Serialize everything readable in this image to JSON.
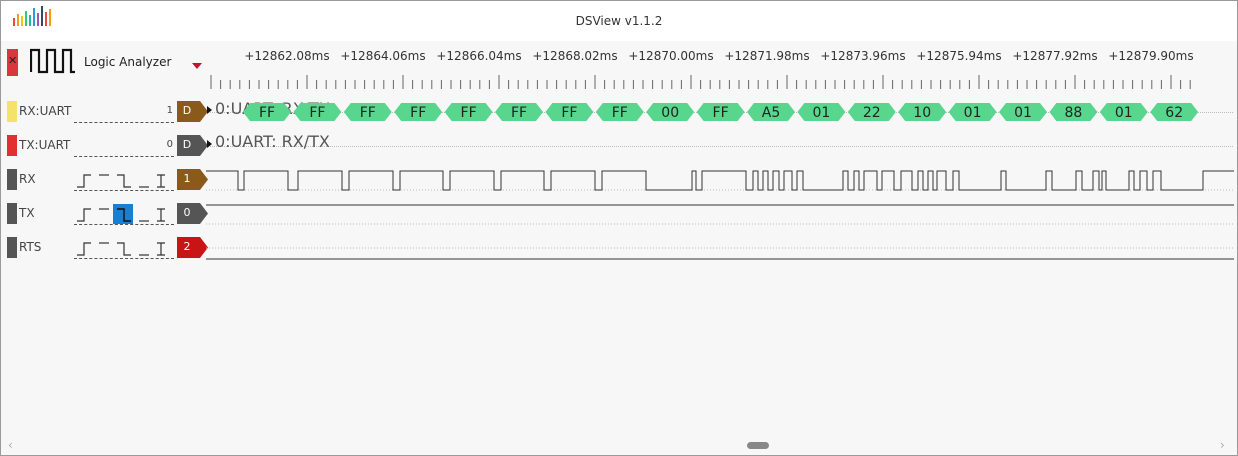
{
  "window": {
    "title": "DSView v1.1.2",
    "logo_icon": "dsview-logo-icon"
  },
  "toolbar": {
    "mode_label": "Logic Analyzer",
    "mode_icon": "logic-analyzer-icon",
    "accent_color": "#c8102e"
  },
  "ruler": {
    "labels": [
      "+12862.08ms",
      "+12864.06ms",
      "+12866.04ms",
      "+12868.02ms",
      "+12870.00ms",
      "+12871.98ms",
      "+12873.96ms",
      "+12875.94ms",
      "+12877.92ms",
      "+12879.90ms"
    ]
  },
  "channels": [
    {
      "name": "RX:UART",
      "number": "1",
      "tag": "D",
      "color": "#f5e26b",
      "tag_color": "#8a5a1a",
      "type": "decoder"
    },
    {
      "name": "TX:UART",
      "number": "0",
      "tag": "D",
      "color": "#e0302f",
      "tag_color": "#555555",
      "type": "decoder"
    },
    {
      "name": "RX",
      "number": "",
      "tag": "1",
      "color": "#555555",
      "tag_color": "#8a5a1a",
      "type": "logic"
    },
    {
      "name": "TX",
      "number": "",
      "tag": "0",
      "color": "#555555",
      "tag_color": "#555555",
      "type": "logic",
      "trigger_selected": "falling-edge"
    },
    {
      "name": "RTS",
      "number": "",
      "tag": "2",
      "color": "#555555",
      "tag_color": "#c81414",
      "type": "logic"
    }
  ],
  "decoders": {
    "rx_label": "0:UART: RX/TX",
    "tx_label": "0:UART: RX/TX",
    "rx_bytes": [
      "FF",
      "FF",
      "FF",
      "FF",
      "FF",
      "FF",
      "FF",
      "FF",
      "00",
      "FF",
      "A5",
      "01",
      "22",
      "10",
      "01",
      "01",
      "88",
      "01",
      "62"
    ],
    "byte_color": "#58d68d"
  },
  "scrollbar": {
    "left_icon": "chevron-left-icon",
    "right_icon": "chevron-right-icon"
  }
}
